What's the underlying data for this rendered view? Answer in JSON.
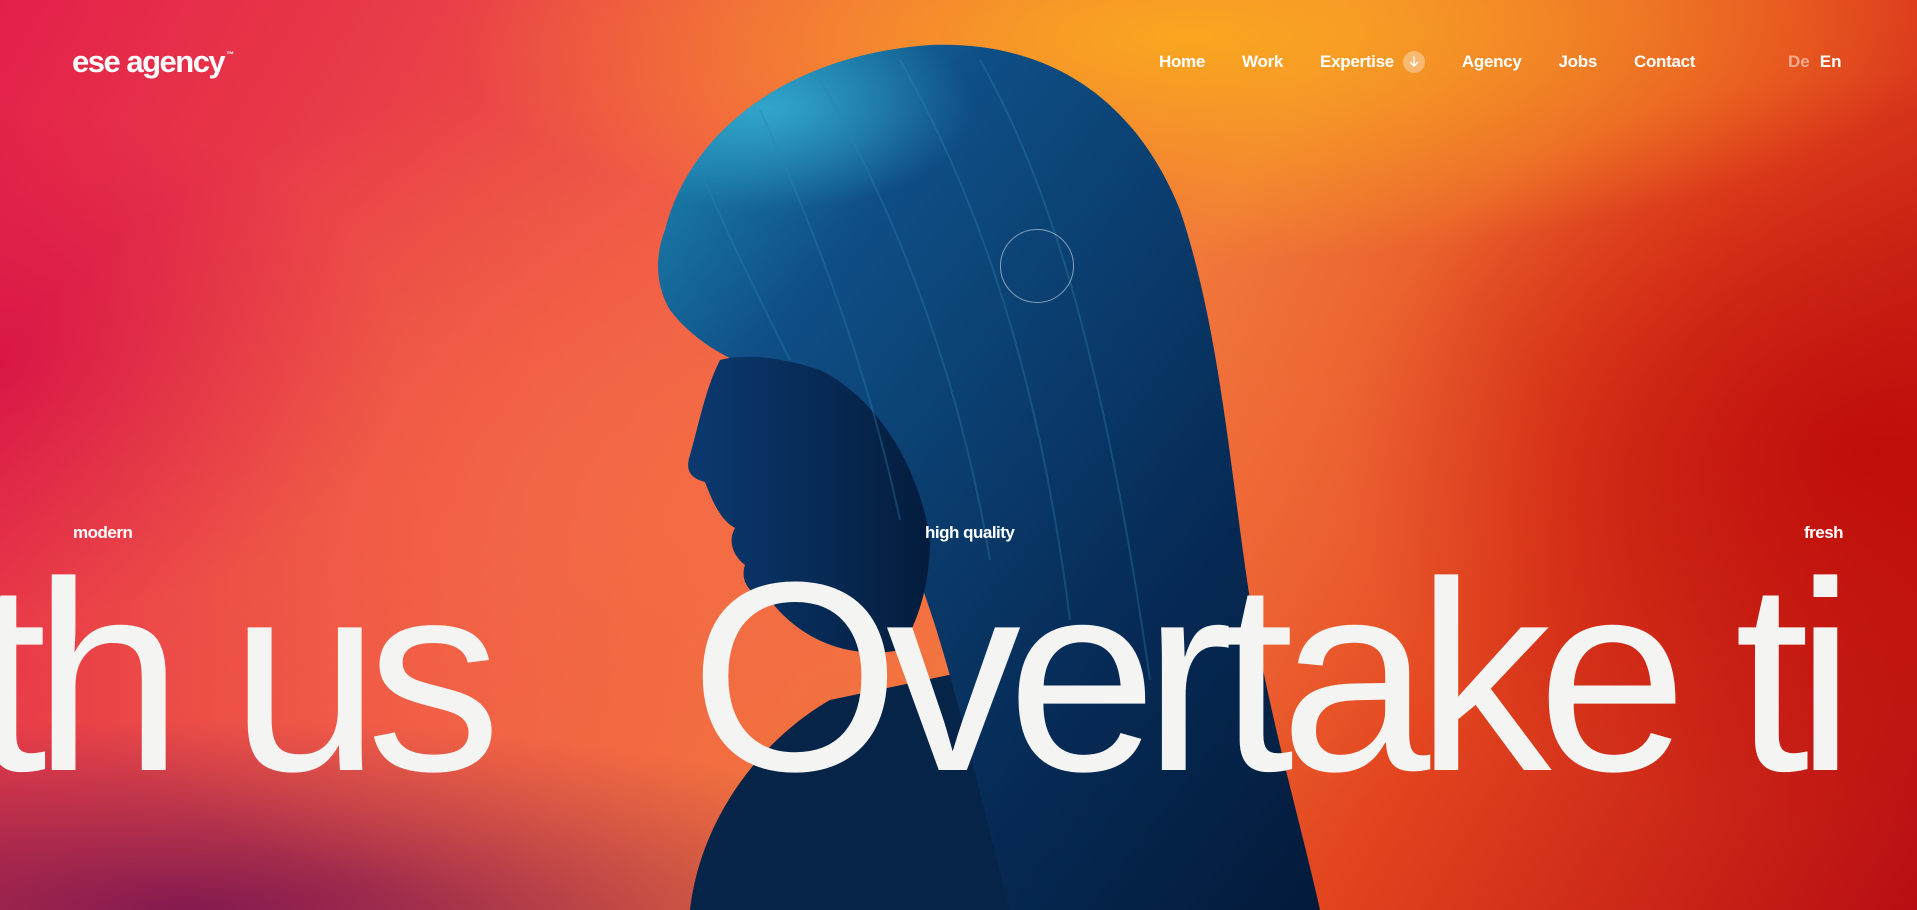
{
  "brand": {
    "logo_text": "ese agency",
    "trademark": "™"
  },
  "nav": {
    "items": [
      {
        "label": "Home"
      },
      {
        "label": "Work"
      },
      {
        "label": "Expertise",
        "has_dropdown": true
      },
      {
        "label": "Agency"
      },
      {
        "label": "Jobs"
      },
      {
        "label": "Contact"
      }
    ],
    "dropdown_icon": "arrow-down-icon"
  },
  "languages": {
    "options": [
      "De",
      "En"
    ],
    "active": "En"
  },
  "hero": {
    "tags": {
      "left": "modern",
      "middle": "high quality",
      "right": "fresh"
    },
    "marquee": {
      "segment_a": "th us",
      "segment_b": "Overtake ti"
    }
  },
  "colors": {
    "text": "#ffffff",
    "headline": "#f4f4f2",
    "background_orange": "#f07a38",
    "background_red": "#b80d12",
    "background_magenta": "#e3204a",
    "silhouette": "#062a55"
  }
}
